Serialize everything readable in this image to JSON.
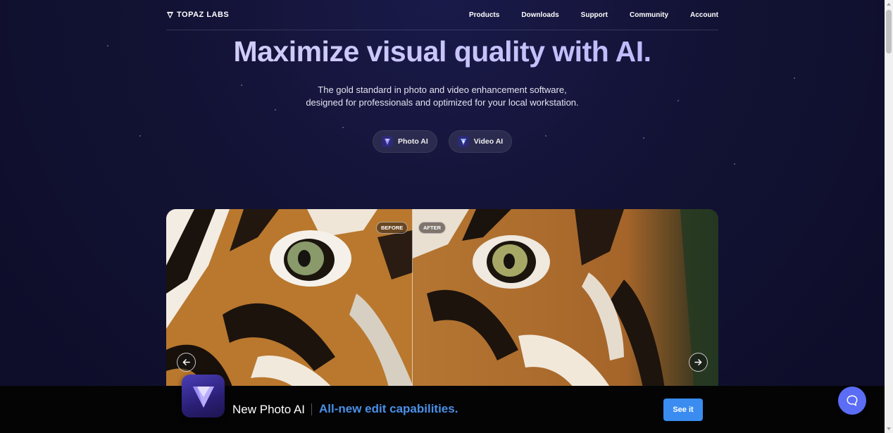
{
  "brand": {
    "name": "TOPAZ LABS"
  },
  "nav": {
    "items": [
      "Products",
      "Downloads",
      "Support",
      "Community",
      "Account"
    ]
  },
  "hero": {
    "title": "Maximize visual quality with AI.",
    "subtitle_line1": "The gold standard in photo and video enhancement software,",
    "subtitle_line2": "designed for professionals and optimized for your local workstation.",
    "pills": [
      {
        "label": "Photo AI",
        "icon": "photo-ai-icon"
      },
      {
        "label": "Video AI",
        "icon": "video-ai-icon"
      }
    ]
  },
  "comparison": {
    "before_label": "BEFORE",
    "after_label": "AFTER",
    "prev_icon": "arrow-left-icon",
    "next_icon": "arrow-right-icon"
  },
  "banner": {
    "title": "New Photo AI",
    "tagline": "All-new edit capabilities.",
    "cta": "See it",
    "accent_color": "#4a90e8",
    "button_color": "#3a8cf0"
  },
  "chat": {
    "icon": "chat-bubble-icon"
  }
}
